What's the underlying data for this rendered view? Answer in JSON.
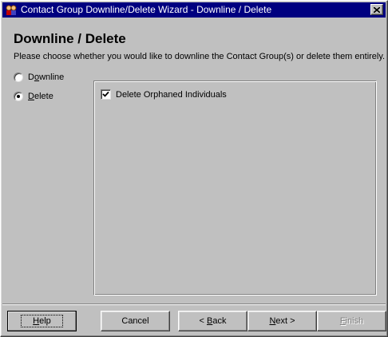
{
  "window": {
    "title": "Contact Group Downline/Delete Wizard - Downline / Delete",
    "close_label": "×"
  },
  "page": {
    "heading": "Downline / Delete",
    "instructions": "Please choose whether you would like to downline the Contact Group(s) or delete them entirely."
  },
  "options": {
    "downline_label": "Downline",
    "delete_label": "Delete",
    "selected": "Delete"
  },
  "delete_options": {
    "delete_orphaned_label": "Delete Orphaned Individuals",
    "delete_orphaned_checked": true
  },
  "buttons": {
    "help": "Help",
    "cancel": "Cancel",
    "back": "< Back",
    "next": "Next >",
    "finish": "Finish"
  }
}
